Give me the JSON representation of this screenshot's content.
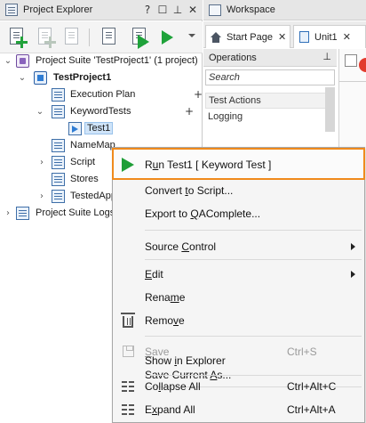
{
  "project_explorer": {
    "title": "Project Explorer",
    "title_buttons": [
      "?",
      "☐",
      "⊥",
      "✕"
    ],
    "toolbar_icons": [
      "add-new-item-icon",
      "add-existing-item-icon",
      "add-file-icon",
      "properties-icon",
      "run-icon",
      "run-suite-icon"
    ],
    "tree": {
      "suite": "Project Suite 'TestProject1' (1 project)",
      "project": "TestProject1",
      "execution_plan": "Execution Plan",
      "keyword_tests": "KeywordTests",
      "test1": "Test1",
      "namemapping": "NameMap",
      "script": "Script",
      "stores": "Stores",
      "tested_apps": "TestedApp",
      "suite_logs": "Project Suite Logs"
    }
  },
  "workspace": {
    "title": "Workspace",
    "tabs": [
      {
        "label": "Start Page",
        "close": "✕"
      },
      {
        "label": "Unit1",
        "close": "✕"
      }
    ],
    "operations": {
      "title": "Operations",
      "pin": "⊥",
      "search_placeholder": "Search",
      "group": "Test Actions",
      "item": "Logging"
    }
  },
  "context_menu": {
    "items": {
      "run": {
        "pre": "R",
        "ul": "u",
        "post": "n Test1  [ Keyword Test ]"
      },
      "convert": {
        "pre": "Convert ",
        "ul": "t",
        "post": "o Script..."
      },
      "export": {
        "pre": "Export to ",
        "ul": "Q",
        "post": "AComplete..."
      },
      "source_control": {
        "pre": "Source ",
        "ul": "C",
        "post": "ontrol"
      },
      "edit": {
        "pre": "",
        "ul": "E",
        "post": "dit"
      },
      "rename": {
        "pre": "Rena",
        "ul": "m",
        "post": "e"
      },
      "remove": {
        "pre": "Remo",
        "ul": "v",
        "post": "e"
      },
      "save": {
        "pre": "",
        "ul": "S",
        "post": "ave"
      },
      "save_shortcut": "Ctrl+S",
      "save_current": {
        "pre": "Save Current ",
        "ul": "A",
        "post": "s..."
      },
      "show_explorer": {
        "pre": "Show ",
        "ul": "i",
        "post": "n Explorer"
      },
      "collapse_all": {
        "pre": "Co",
        "ul": "l",
        "post": "lapse All"
      },
      "collapse_shortcut": "Ctrl+Alt+C",
      "expand_all": {
        "pre": "E",
        "ul": "x",
        "post": "pand All"
      },
      "expand_shortcut": "Ctrl+Alt+A"
    }
  },
  "colors": {
    "highlight_border": "#f08a1c",
    "run_green": "#1f9e37"
  }
}
